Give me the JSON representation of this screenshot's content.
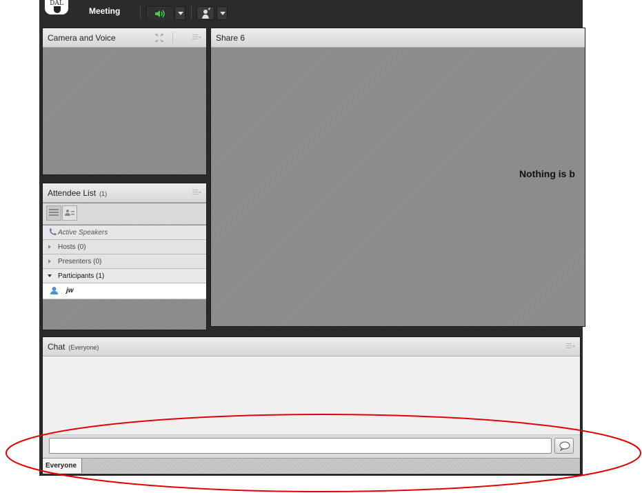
{
  "topbar": {
    "logo_text": "DAL",
    "menu_meeting": "Meeting",
    "audio_active_color": "#39b54a"
  },
  "camera_pod": {
    "title": "Camera and Voice"
  },
  "share_pod": {
    "title": "Share 6",
    "message": "Nothing is b"
  },
  "attendee_pod": {
    "title": "Attendee List",
    "count": "(1)",
    "active_speakers": "Active Speakers",
    "groups": [
      {
        "label": "Hosts (0)",
        "expanded": false
      },
      {
        "label": "Presenters (0)",
        "expanded": false
      },
      {
        "label": "Participants (1)",
        "expanded": true
      }
    ],
    "participants": [
      {
        "name": "jw"
      }
    ]
  },
  "chat_pod": {
    "title": "Chat",
    "audience": "(Everyone)",
    "input_value": "",
    "tab_label": "Everyone"
  },
  "annotation": {
    "color": "#e00000",
    "shape": "ellipse"
  }
}
